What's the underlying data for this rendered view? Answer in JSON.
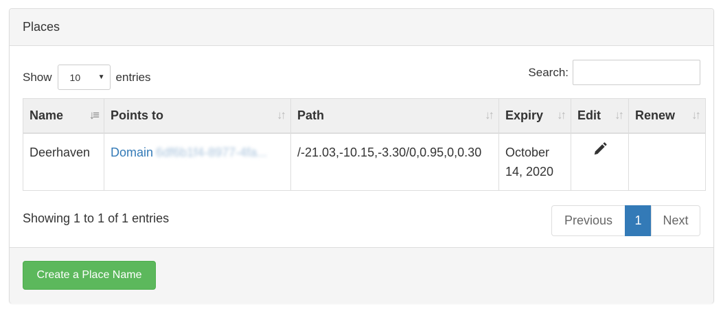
{
  "panel": {
    "title": "Places"
  },
  "length": {
    "show_label": "Show",
    "value": "10",
    "entries_label": "entries"
  },
  "search": {
    "label": "Search:",
    "value": ""
  },
  "table": {
    "headers": [
      "Name",
      "Points to",
      "Path",
      "Expiry",
      "Edit",
      "Renew"
    ],
    "rows": [
      {
        "name": "Deerhaven",
        "points_to_prefix": "Domain",
        "points_to_id": "6df6b1f4-8977-4fa...",
        "path": "/-21.03,-10.15,-3.30/0,0.95,0,0.30",
        "expiry": "October 14, 2020",
        "edit_icon": "pencil-icon",
        "renew": ""
      }
    ]
  },
  "info": "Showing 1 to 1 of 1 entries",
  "pagination": {
    "previous": "Previous",
    "current": "1",
    "next": "Next"
  },
  "footer": {
    "create_button": "Create a Place Name"
  },
  "colors": {
    "link": "#337ab7",
    "active_page": "#337ab7",
    "create_button": "#5cb85c"
  }
}
